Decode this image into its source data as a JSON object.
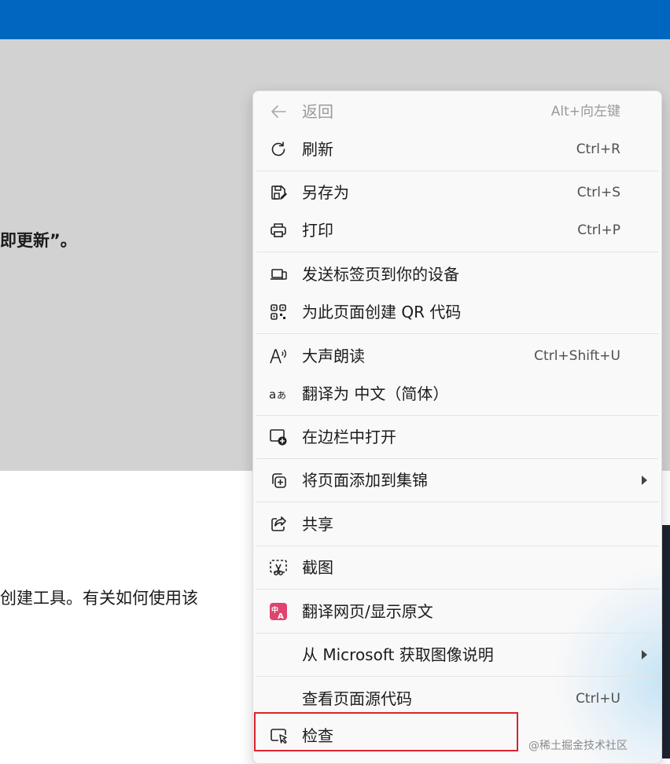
{
  "page": {
    "text_line1": "即更新”。",
    "text_line2": "创建工具。有关如何使用该"
  },
  "context_menu": {
    "items": [
      {
        "label": "返回",
        "shortcut": "Alt+向左键",
        "icon": "back-arrow-icon",
        "disabled": true
      },
      {
        "label": "刷新",
        "shortcut": "Ctrl+R",
        "icon": "refresh-icon"
      },
      {
        "label": "另存为",
        "shortcut": "Ctrl+S",
        "icon": "save-as-icon"
      },
      {
        "label": "打印",
        "shortcut": "Ctrl+P",
        "icon": "printer-icon"
      },
      {
        "label": "发送标签页到你的设备",
        "shortcut": "",
        "icon": "send-to-devices-icon"
      },
      {
        "label": "为此页面创建 QR 代码",
        "shortcut": "",
        "icon": "qr-code-icon"
      },
      {
        "label": "大声朗读",
        "shortcut": "Ctrl+Shift+U",
        "icon": "read-aloud-icon"
      },
      {
        "label": "翻译为 中文（简体）",
        "shortcut": "",
        "icon": "translate-icon"
      },
      {
        "label": "在边栏中打开",
        "shortcut": "",
        "icon": "sidebar-open-icon"
      },
      {
        "label": "将页面添加到集锦",
        "shortcut": "",
        "icon": "collections-add-icon",
        "submenu": true
      },
      {
        "label": "共享",
        "shortcut": "",
        "icon": "share-icon"
      },
      {
        "label": "截图",
        "shortcut": "",
        "icon": "screenshot-icon"
      },
      {
        "label": "翻译网页/显示原文",
        "shortcut": "",
        "icon": "translate-page-icon"
      },
      {
        "label": "从 Microsoft 获取图像说明",
        "shortcut": "",
        "icon": "",
        "submenu": true
      },
      {
        "label": "查看页面源代码",
        "shortcut": "Ctrl+U",
        "icon": ""
      },
      {
        "label": "检查",
        "shortcut": "",
        "icon": "inspect-icon"
      }
    ]
  },
  "watermark": "@稀土掘金技术社区",
  "colors": {
    "top_bar": "#0067c0",
    "gray_panel": "#d2d2d2",
    "menu_bg": "#f9f9f9",
    "highlight_border": "#d9242e",
    "translate_page_icon": "#e0436e"
  }
}
